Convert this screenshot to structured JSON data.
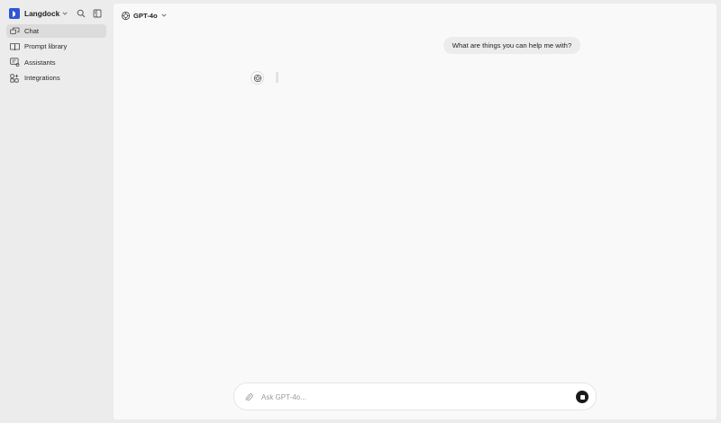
{
  "app": {
    "brand_name": "Langdock",
    "brand_color": "#2f54d6"
  },
  "sidebar": {
    "items": [
      {
        "label": "Chat",
        "icon": "chat-icon",
        "active": true
      },
      {
        "label": "Prompt library",
        "icon": "book-icon",
        "active": false
      },
      {
        "label": "Assistants",
        "icon": "assistant-icon",
        "active": false
      },
      {
        "label": "Integrations",
        "icon": "integrations-icon",
        "active": false
      }
    ],
    "actions": [
      {
        "icon": "search-icon"
      },
      {
        "icon": "sidebar-toggle-icon"
      }
    ]
  },
  "header": {
    "model_name": "GPT-4o",
    "model_icon": "openai-icon"
  },
  "conversation": {
    "user_message": "What are things you can help me with?",
    "assistant_avatar_icon": "openai-icon"
  },
  "composer": {
    "placeholder": "Ask GPT-4o...",
    "value": "",
    "attach_icon": "paperclip-icon",
    "stop_icon": "stop-icon"
  }
}
